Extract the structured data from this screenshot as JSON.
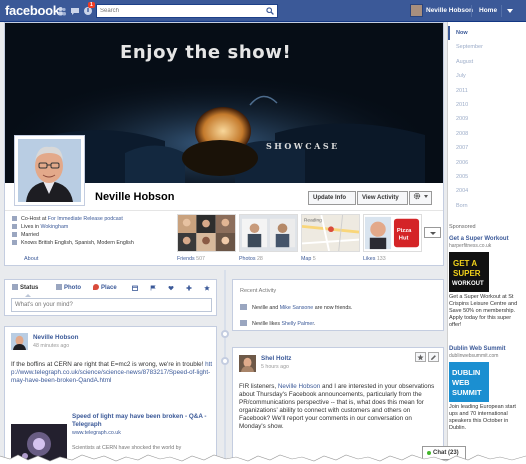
{
  "topbar": {
    "logo": "facebook",
    "notification_count": "1",
    "search_placeholder": "Search",
    "user_name": "Neville Hobson",
    "home_label": "Home"
  },
  "cover": {
    "headline": "Enjoy the show!",
    "caption": "SHOWCASE"
  },
  "profile": {
    "name": "Neville Hobson",
    "update_info_label": "Update Info",
    "view_activity_label": "View Activity",
    "about": [
      {
        "prefix": "Co-Host at ",
        "link": "For Immediate Release podcast"
      },
      {
        "prefix": "Lives in ",
        "link": "Wokingham"
      },
      {
        "prefix": "Married",
        "link": ""
      },
      {
        "prefix": "Knows British English, Spanish, Modern English",
        "link": ""
      }
    ],
    "about_link": "About"
  },
  "tiles": [
    {
      "label": "Friends",
      "count": "507"
    },
    {
      "label": "Photos",
      "count": "28"
    },
    {
      "label": "Map",
      "count": "5"
    },
    {
      "label": "Likes",
      "count": "133"
    }
  ],
  "scrubber": [
    "Now",
    "September",
    "August",
    "July",
    "2011",
    "2010",
    "2009",
    "2008",
    "2007",
    "2006",
    "2005",
    "2004",
    "Born"
  ],
  "composer": {
    "tabs": [
      "Status",
      "Photo",
      "Place"
    ],
    "placeholder": "What's on your mind?"
  },
  "recent_activity": {
    "title": "Recent Activity",
    "items": [
      {
        "a": "Neville and ",
        "b": "Mike Sansone",
        "c": " are now friends."
      },
      {
        "a": "Neville likes ",
        "b": "Shelly Palmer",
        "c": "."
      }
    ]
  },
  "story_left": {
    "author": "Neville Hobson",
    "time": "48 minutes ago",
    "text_prefix": "If the boffins at CERN are right that E=mc2 is wrong, we're in trouble! ",
    "text_link": "http://www.telegraph.co.uk/science/science-news/8783217/Speed-of-light-may-have-been-broken-QandA.html",
    "card_title": "Speed of light may have been broken - Q&A - Telegraph",
    "card_url": "www.telegraph.co.uk",
    "card_snippet": "Scientists at CERN have shocked the world by"
  },
  "story_right": {
    "author": "Shel Holtz",
    "time": "5 hours ago",
    "text_a": "FIR listeners, ",
    "text_link": "Neville Hobson",
    "text_b": " and I are interested in your observations about Thursday's Facebook announcements, particularly from the PR/communications perspective -- that is, what does this mean for organizations' ability to connect with customers and others on Facebook? We'll report your comments in our conversation on Monday's show."
  },
  "ads": {
    "sponsored_label": "Sponsored",
    "items": [
      {
        "title": "Get a Super Workout",
        "url": "harperfitness.co.uk",
        "img_text_1": "GET A",
        "img_text_2": "SUPER",
        "img_text_3": "WORKOUT",
        "body": "Get a Super Workout at St Crispins Leisure Centre and Save 50% on membership. Apply today for this super offer!"
      },
      {
        "title": "Dublin Web Summit",
        "url": "dublinwebsummit.com",
        "img_text_1": "DUBLIN",
        "img_text_2": "WEB",
        "img_text_3": "SUMMIT",
        "body": "Join leading European start ups and 70 international speakers this October in Dublin."
      }
    ]
  },
  "chat": {
    "label": "Chat (23)"
  },
  "colors": {
    "brand": "#3b5998",
    "link": "#3b5998",
    "background": "#e9ebee"
  }
}
